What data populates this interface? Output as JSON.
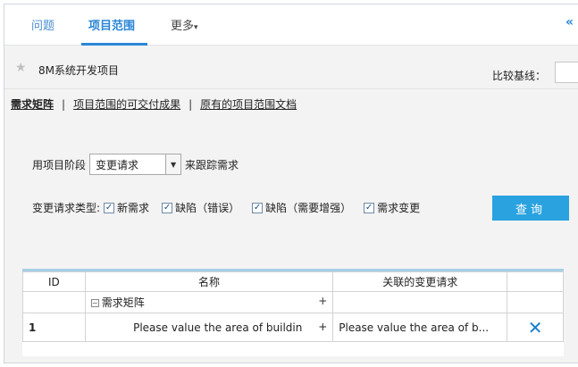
{
  "nav": {
    "tabs": [
      {
        "label": "问题"
      },
      {
        "label": "项目范围"
      }
    ],
    "more_label": "更多",
    "collapse_glyph": "«"
  },
  "project": {
    "name": "8M系统开发项目",
    "baseline_label": "比较基线："
  },
  "sublinks": [
    {
      "label": "需求矩阵"
    },
    {
      "label": "项目范围的可交付成果"
    },
    {
      "label": "原有的项目范围文档"
    }
  ],
  "filter": {
    "prefix": "用项目阶段",
    "stage_value": "变更请求",
    "suffix": "来跟踪需求",
    "types_label": "变更请求类型:",
    "types": [
      {
        "label": "新需求",
        "checked": true
      },
      {
        "label": "缺陷（错误）",
        "checked": true
      },
      {
        "label": "缺陷（需要增强）",
        "checked": true
      },
      {
        "label": "需求变更",
        "checked": true
      }
    ],
    "query_label": "查询"
  },
  "table": {
    "headers": [
      "ID",
      "名称",
      "关联的变更请求",
      ""
    ],
    "rows": [
      {
        "id": "",
        "name": "需求矩阵",
        "related": ""
      },
      {
        "id": "1",
        "name": "Please value the area of buildin",
        "related": "Please value the area of b..."
      }
    ],
    "plus": "+"
  },
  "icons": {
    "star": "star-icon",
    "dropdown": "chevron-down-icon",
    "delete": "close-icon"
  },
  "colors": {
    "accent": "#2a86d6",
    "button": "#2aa2e0"
  }
}
